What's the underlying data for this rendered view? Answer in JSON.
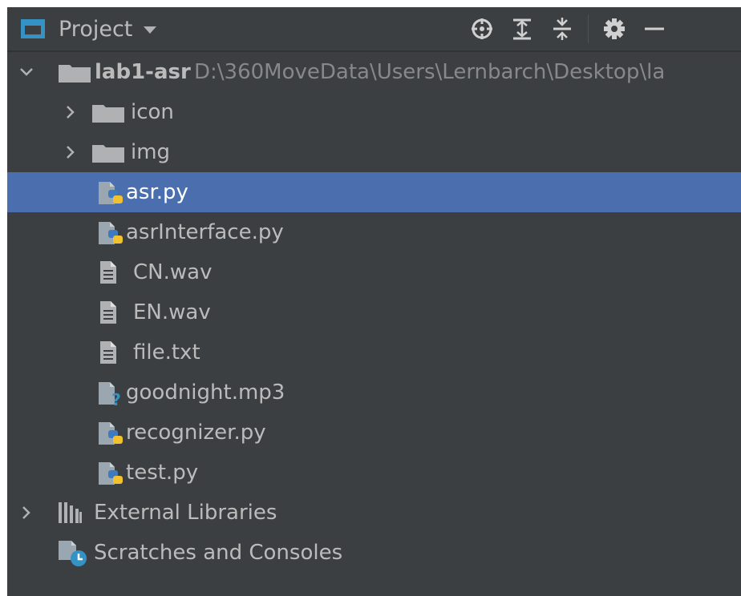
{
  "header": {
    "title": "Project",
    "tools": [
      "target-icon",
      "expand-all-icon",
      "collapse-all-icon",
      "gear-icon",
      "minimize-icon"
    ]
  },
  "tree": {
    "root": {
      "name": "lab1-asr",
      "path": "D:\\360MoveData\\Users\\Lernbarch\\Desktop\\la"
    },
    "folders": [
      {
        "name": "icon"
      },
      {
        "name": "img"
      }
    ],
    "files": [
      {
        "name": "asr.py",
        "type": "python",
        "selected": true
      },
      {
        "name": "asrInterface.py",
        "type": "python"
      },
      {
        "name": "CN.wav",
        "type": "text"
      },
      {
        "name": "EN.wav",
        "type": "text"
      },
      {
        "name": "file.txt",
        "type": "text"
      },
      {
        "name": "goodnight.mp3",
        "type": "unknown"
      },
      {
        "name": "recognizer.py",
        "type": "python"
      },
      {
        "name": "test.py",
        "type": "python"
      }
    ],
    "external_libraries": "External Libraries",
    "scratches": "Scratches and Consoles"
  },
  "colors": {
    "background": "#3c3f41",
    "selection": "#4b6eaf",
    "text": "#bbbbbb",
    "path_text": "#888888",
    "folder": "#afb1b3"
  }
}
